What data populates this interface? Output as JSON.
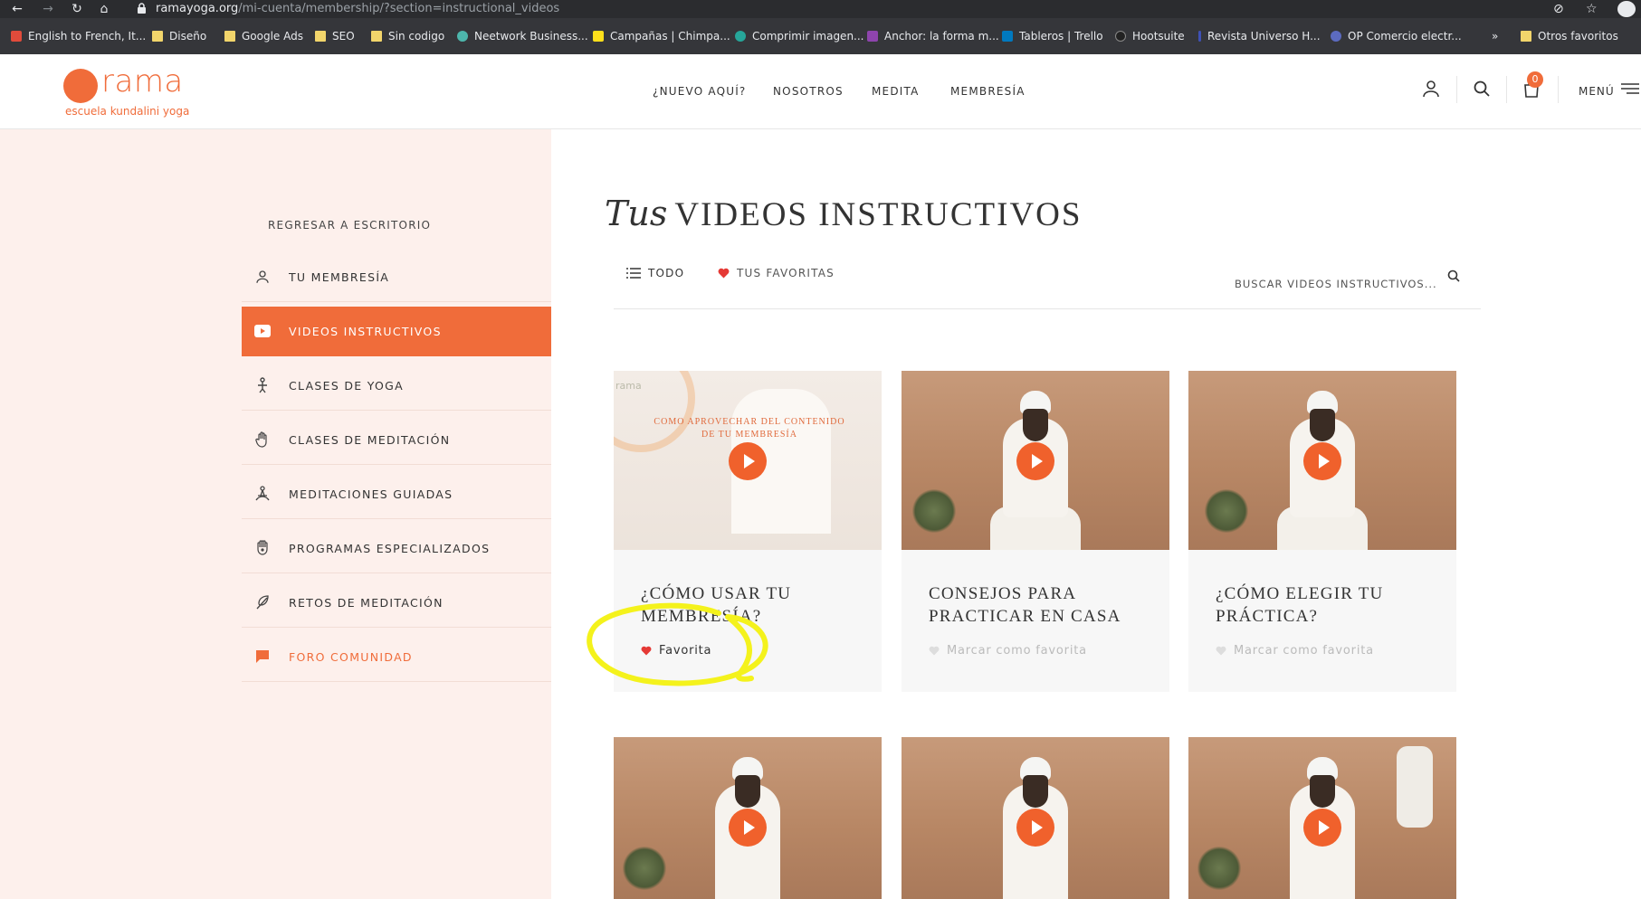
{
  "browser": {
    "url_domain": "ramayoga.org",
    "url_path": "/mi-cuenta/membership/?section=instructional_videos",
    "bookmarks": [
      {
        "label": "English to French, It...",
        "color": "#e14b3b"
      },
      {
        "label": "Diseño",
        "color": "#f2d56b"
      },
      {
        "label": "Google Ads",
        "color": "#f2d56b"
      },
      {
        "label": "SEO",
        "color": "#f2d56b"
      },
      {
        "label": "Sin codigo",
        "color": "#f2d56b"
      },
      {
        "label": "Neetwork Business...",
        "color": "#4db6ac"
      },
      {
        "label": "Campañas | Chimpa...",
        "color": "#ffe01b"
      },
      {
        "label": "Comprimir imagen...",
        "color": "#26a69a"
      },
      {
        "label": "Anchor: la forma m...",
        "color": "#8e44ad"
      },
      {
        "label": "Tableros | Trello",
        "color": "#0079bf"
      },
      {
        "label": "Hootsuite",
        "color": "#222222"
      },
      {
        "label": "Revista Universo H...",
        "color": "#3f51b5"
      },
      {
        "label": "OP Comercio electr...",
        "color": "#5c6bc0"
      }
    ],
    "more_label": "»",
    "other_bookmarks": "Otros favoritos"
  },
  "site": {
    "logo_word": "rama",
    "logo_tagline": "escuela kundalini yoga",
    "nav": [
      "¿NUEVO AQUÍ?",
      "NOSOTROS",
      "MEDITA",
      "MEMBRESÍA"
    ],
    "cart_count": "0",
    "menu_label": "MENÚ",
    "accent_color": "#f06c3a"
  },
  "sidebar": {
    "back_label": "REGRESAR A ESCRITORIO",
    "items": [
      {
        "label": "TU MEMBRESÍA",
        "icon": "user-icon"
      },
      {
        "label": "VIDEOS INSTRUCTIVOS",
        "icon": "youtube-icon",
        "active": true
      },
      {
        "label": "CLASES DE YOGA",
        "icon": "yoga-pose-icon"
      },
      {
        "label": "CLASES DE MEDITACIÓN",
        "icon": "hand-icon"
      },
      {
        "label": "MEDITACIONES GUIADAS",
        "icon": "meditation-icon"
      },
      {
        "label": "PROGRAMAS ESPECIALIZADOS",
        "icon": "hamsa-icon"
      },
      {
        "label": "RETOS DE MEDITACIÓN",
        "icon": "feather-icon"
      },
      {
        "label": "FORO COMUNIDAD",
        "icon": "chat-icon"
      }
    ]
  },
  "main": {
    "title_script": "Tus",
    "title": "VIDEOS INSTRUCTIVOS",
    "tabs": {
      "all": "TODO",
      "favorites": "TUS FAVORITAS"
    },
    "search_placeholder": "BUSCAR VIDEOS INSTRUCTIVOS...",
    "cards": [
      {
        "title": "¿CÓMO USAR TU MEMBRESÍA?",
        "fav_label": "Favorita",
        "favorited": true,
        "thumb_text": "COMO APROVECHAR DEL CONTENIDO DE TU MEMBRESÍA",
        "thumb_brand": "rama"
      },
      {
        "title": "CONSEJOS PARA PRACTICAR EN CASA",
        "fav_label": "Marcar como favorita",
        "favorited": false
      },
      {
        "title": "¿CÓMO ELEGIR TU PRÁCTICA?",
        "fav_label": "Marcar como favorita",
        "favorited": false
      }
    ]
  }
}
